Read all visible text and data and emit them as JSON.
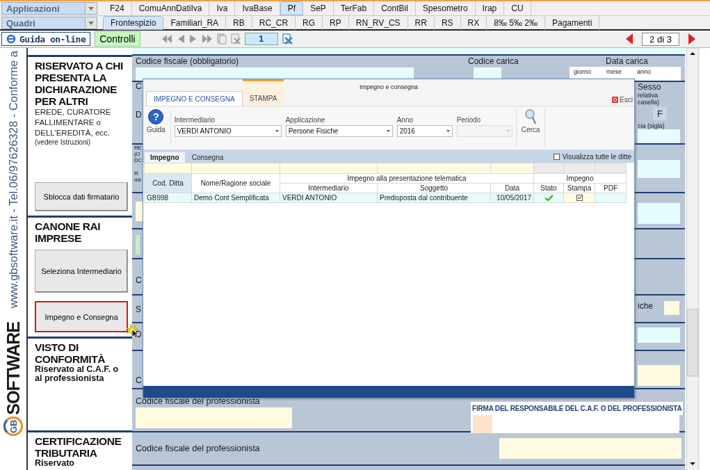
{
  "menu_rows": [
    {
      "combo": {
        "value": "Applicazioni"
      },
      "tabs": [
        {
          "label": "F24",
          "selected": false
        },
        {
          "label": "ComuAnnDatiIva",
          "selected": false
        },
        {
          "label": "Iva",
          "selected": false
        },
        {
          "label": "IvaBase",
          "selected": false
        },
        {
          "label": "Pf",
          "selected": true
        },
        {
          "label": "SeP",
          "selected": false
        },
        {
          "label": "TerFab",
          "selected": false
        },
        {
          "label": "ContBil",
          "selected": false
        },
        {
          "label": "Spesometro",
          "selected": false
        },
        {
          "label": "Irap",
          "selected": false
        },
        {
          "label": "CU",
          "selected": false
        }
      ]
    },
    {
      "combo": {
        "value": "Quadri"
      },
      "tabs": [
        {
          "label": "Frontespizio",
          "selected": true
        },
        {
          "label": "Familiari_RA",
          "selected": false
        },
        {
          "label": "RB",
          "selected": false
        },
        {
          "label": "RC_CR",
          "selected": false
        },
        {
          "label": "RG",
          "selected": false
        },
        {
          "label": "RP",
          "selected": false
        },
        {
          "label": "RN_RV_CS",
          "selected": false
        },
        {
          "label": "RR",
          "selected": false
        },
        {
          "label": "RS",
          "selected": false
        },
        {
          "label": "RX",
          "selected": false
        },
        {
          "label": "8‰ 5‰ 2‰",
          "selected": false
        },
        {
          "label": "Pagamenti",
          "selected": false
        }
      ]
    }
  ],
  "toolbar": {
    "help_button": "Guida on-line",
    "checks_button": "Controlli",
    "page_field": "1",
    "page_indicator": "2 di 3"
  },
  "side_strip": {
    "text": "www.gbsoftware.it - Tel.06/97626328 - Conforme a",
    "logo_mark": "GB",
    "logo_text": "SOFTWARE"
  },
  "sidebar": {
    "items": [
      {
        "kind": "heading",
        "text": "RISERVATO A CHI PRESENTA LA DICHIARAZIONE PER ALTRI"
      },
      {
        "kind": "text",
        "text": "EREDE, CURATORE FALLIMENTARE o DELL’EREDITÀ, ecc."
      },
      {
        "kind": "note",
        "text": "(vedere Istruzioni)"
      },
      {
        "kind": "button",
        "label": "Sblocca dati firmatario",
        "selected": false
      },
      {
        "kind": "heading",
        "text": "CANONE RAI IMPRESE"
      },
      {
        "kind": "button",
        "label": "Seleziona Intermediario",
        "selected": false
      },
      {
        "kind": "button",
        "label": "Impegno e Consegna",
        "selected": true
      },
      {
        "kind": "heading",
        "text": "VISTO DI CONFORMITÀ"
      },
      {
        "kind": "subheading",
        "text": "Riservato al C.A.F. o al professionista"
      },
      {
        "kind": "heading",
        "text": "CERTIFICAZIONE TRIBUTARIA"
      },
      {
        "kind": "subheading",
        "text": "Riservato"
      }
    ]
  },
  "form": {
    "fiscal_code_label": "Codice fiscale (obbligatorio)",
    "role_code_label": "Codice carica",
    "role_date_label": "Data carica",
    "day_label": "giorno",
    "month_label": "mese",
    "year_label": "anno",
    "left_fragments": [
      "C",
      "D",
      "RE (O DC",
      "R res",
      "C",
      "S",
      "D",
      "C"
    ],
    "sex_label": "Sesso",
    "sex_hint": "relativa casella)",
    "sex_value": "F",
    "province_label": "cia (sigla)",
    "right_fragment": "iche",
    "professional_code_label_1": "Codice fiscale del professionista",
    "signature_label": "FIRMA DEL RESPONSABILE DEL C.A.F. O DEL PROFESSIONISTA",
    "professional_code_label_2": "Codice fiscale del professionista"
  },
  "dialog": {
    "title": "Impegno e consegna",
    "tabs": [
      {
        "label": "IMPEGNO E CONSEGNA",
        "selected": true
      },
      {
        "label": "STAMPA",
        "selected": false
      }
    ],
    "exit_button": "Esci",
    "help_icon": "?",
    "help_button": "Guida",
    "filters": [
      {
        "label": "Intermediario",
        "value": "VERDI ANTONIO",
        "disabled": false
      },
      {
        "label": "Applicazione",
        "value": "Persone Fisiche",
        "disabled": false
      },
      {
        "label": "Anno",
        "value": "2016",
        "disabled": false
      },
      {
        "label": "Periodo",
        "disabled": true
      }
    ],
    "search_button": "Cerca",
    "subtabs": [
      {
        "label": "Impegno",
        "selected": true
      },
      {
        "label": "Consegna",
        "selected": false
      }
    ],
    "show_all": {
      "label": "Visualizza tutte le ditte",
      "checked": false
    },
    "table": {
      "group_headers": [
        "Impegno alla presentazione telematica",
        "Impegno"
      ],
      "columns": [
        "Cod. Ditta",
        "Nome/Ragione sociale",
        "Intermediario",
        "Soggetto",
        "Data",
        "Stato",
        "Stampa",
        "PDF"
      ],
      "rows": [
        {
          "code": "GB998",
          "name": "Demo Cont Semplificata",
          "intermediary": "VERDI ANTONIO",
          "subject": "Predisposta dal contribuente",
          "date": "10/05/2017",
          "status_ok": true,
          "printed": true
        }
      ]
    }
  }
}
